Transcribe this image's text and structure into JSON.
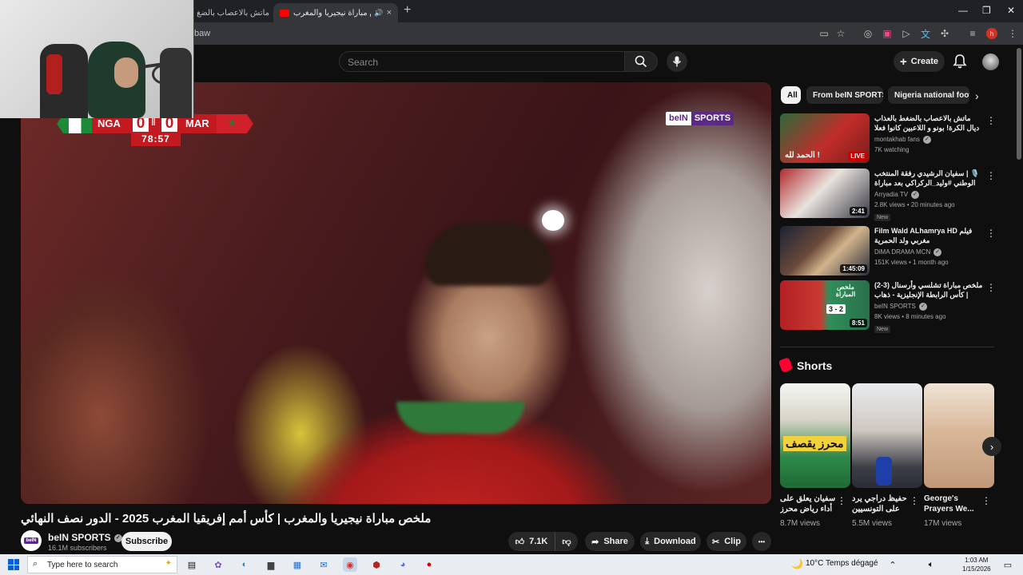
{
  "browser": {
    "tabs": [
      {
        "label": "ماتش بالاعصاب بالضغ",
        "active": false
      },
      {
        "label": "ملخص مباراة نيجيريا والمغرب",
        "active": true
      }
    ],
    "close_glyph": "×",
    "new_tab_glyph": "+",
    "url_fragment": "baw",
    "profile_letter": "h"
  },
  "header": {
    "search_placeholder": "Search",
    "create_label": "Create"
  },
  "video": {
    "scorebug": {
      "home": "NGA",
      "away": "MAR",
      "home_score": "0",
      "away_score": "0",
      "clock": "78:57"
    },
    "broadcaster_logo_a": "beIN",
    "broadcaster_logo_b": "SPORTS",
    "title": "ملخص مباراة نيجيريا والمغرب | كأس أمم إفريقيا المغرب 2025 - الدور نصف النهائي",
    "channel": {
      "avatar_text": "beIN",
      "name": "beIN SPORTS",
      "subscribers": "16.1M subscribers",
      "subscribe_label": "Subscribe"
    },
    "actions": {
      "likes": "7.1K",
      "share": "Share",
      "download": "Download",
      "clip": "Clip",
      "more": "•••"
    }
  },
  "chips": [
    "All",
    "From beIN SPORTS",
    "Nigeria national footb"
  ],
  "recommendations": [
    {
      "title": "ماتش بالاعصاب بالضغط بالعذاب ديال الكرة! بونو و اللاعبين كانوا فعلا رجال",
      "channel": "montakhab fans",
      "stats": "7K watching",
      "badge": "LIVE",
      "thumb_text": "الحمد لله !",
      "new": ""
    },
    {
      "title": "🎙️ | سفيان الرشيدي رفقة المنتخب الوطني #وليد_الركراكي بعد مباراة نيجيريا",
      "channel": "Arryadia TV",
      "stats": "2.8K views • 20 minutes ago",
      "badge": "2:41",
      "thumb_text": "",
      "new": "New"
    },
    {
      "title": "Film Wald ALhamrya HD فيلم مغربي ولد الحمرية",
      "channel": "DiMA DRAMA MCN",
      "stats": "151K views • 1 month ago",
      "badge": "1:45:09",
      "thumb_text": "",
      "new": ""
    },
    {
      "title": "ملخص مباراة تشلسي وأرسنال (3-2) | كأس الرابطة الإنجليزية - ذهاب نصف النهائي",
      "channel": "beIN SPORTS",
      "stats": "8K views • 8 minutes ago",
      "badge": "8:51",
      "thumb_text": "ملخص المباراة",
      "thumb_score": "3 - 2",
      "new": "New"
    }
  ],
  "shorts": {
    "heading": "Shorts",
    "items": [
      {
        "title": "سفيان يعلق على أداء رياض محرز ف...",
        "views": "8.7M views",
        "thumb_text": "محرز يقصف"
      },
      {
        "title": "حفيظ دراجي يرد على التونسيين",
        "views": "5.5M views",
        "thumb_text": ""
      },
      {
        "title": "George's Prayers We...",
        "views": "17M views",
        "thumb_text": ""
      }
    ]
  },
  "taskbar": {
    "search_placeholder": "Type here to search",
    "weather": "10°C  Temps dégagé",
    "time": "1:03 AM",
    "date": "1/15/2026"
  },
  "colors": {
    "accent_red": "#ff0000",
    "score_red": "#c31a22",
    "bein_purple": "#5b2a86",
    "bg": "#0f0f0f"
  }
}
